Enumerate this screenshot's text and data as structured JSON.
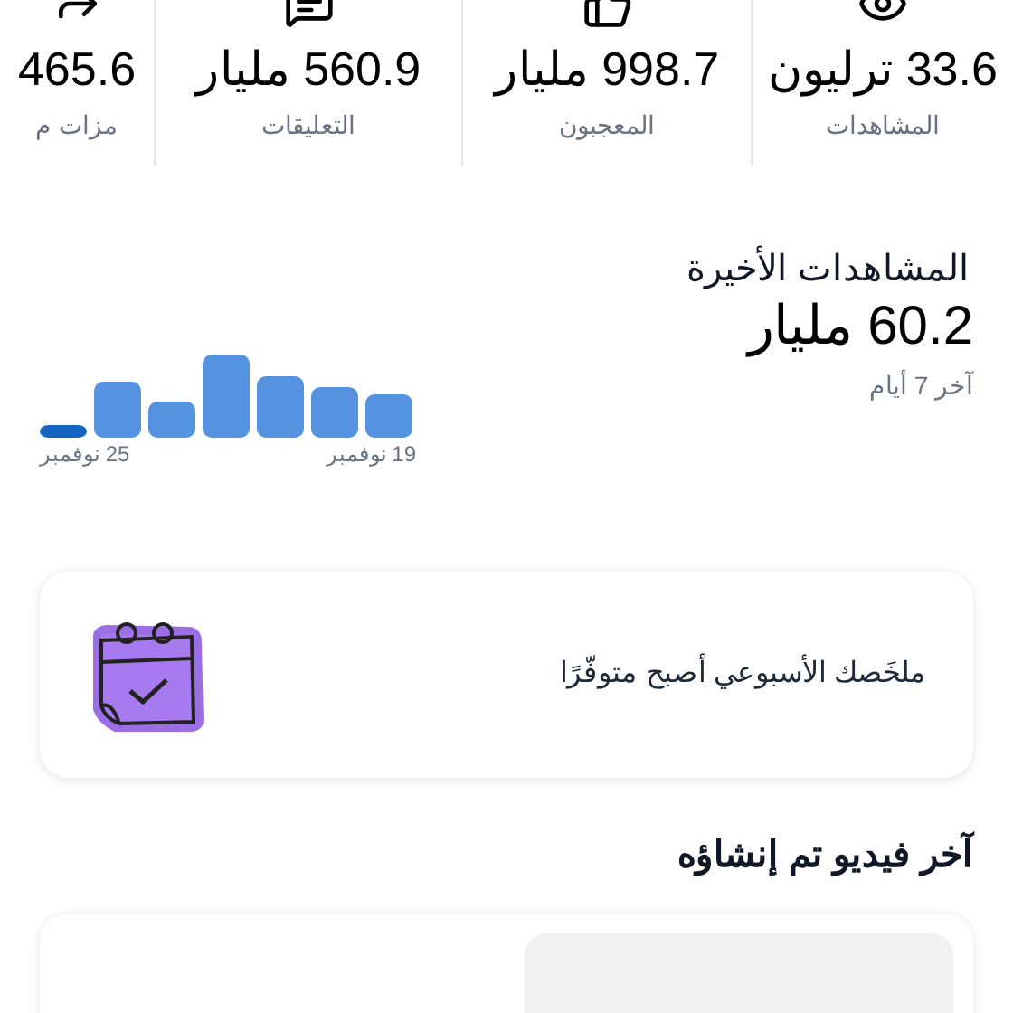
{
  "stats": [
    {
      "kind": "views",
      "value": "33.6 ترليون",
      "label": "المشاهدات"
    },
    {
      "kind": "likes",
      "value": "998.7 مليار",
      "label": "المعجبون"
    },
    {
      "kind": "comments",
      "value": "560.9 مليار",
      "label": "التعليقات"
    },
    {
      "kind": "shares",
      "value": "465.6",
      "label": "مزات م"
    }
  ],
  "recent_views": {
    "title": "المشاهدات الأخيرة",
    "value": "60.2 مليار",
    "period": "آخر 7 أيام",
    "start_label": "19 نوفمبر",
    "end_label": "25 نوفمبر"
  },
  "summary_card": {
    "text": "ملخَصك الأسبوعي أصبح متوفّرًا"
  },
  "latest_video": {
    "heading": "آخر فيديو تم إنشاؤه"
  }
}
